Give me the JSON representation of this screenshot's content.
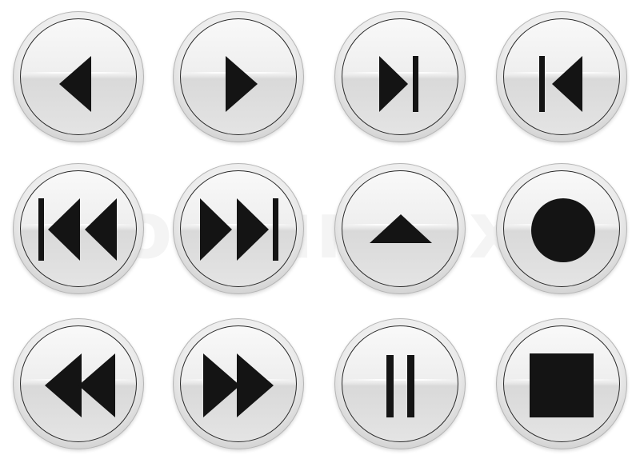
{
  "buttons": [
    {
      "icon": "previous-icon"
    },
    {
      "icon": "play-icon"
    },
    {
      "icon": "skip-to-end-icon"
    },
    {
      "icon": "skip-to-start-icon"
    },
    {
      "icon": "skip-back-icon"
    },
    {
      "icon": "skip-forward-icon"
    },
    {
      "icon": "eject-icon"
    },
    {
      "icon": "record-icon"
    },
    {
      "icon": "rewind-icon"
    },
    {
      "icon": "fast-forward-icon"
    },
    {
      "icon": "pause-icon"
    },
    {
      "icon": "stop-icon"
    }
  ],
  "watermark": "colourbox",
  "colors": {
    "glyph": "#141414",
    "ring": "#2a2a2a",
    "background": "#ffffff"
  }
}
